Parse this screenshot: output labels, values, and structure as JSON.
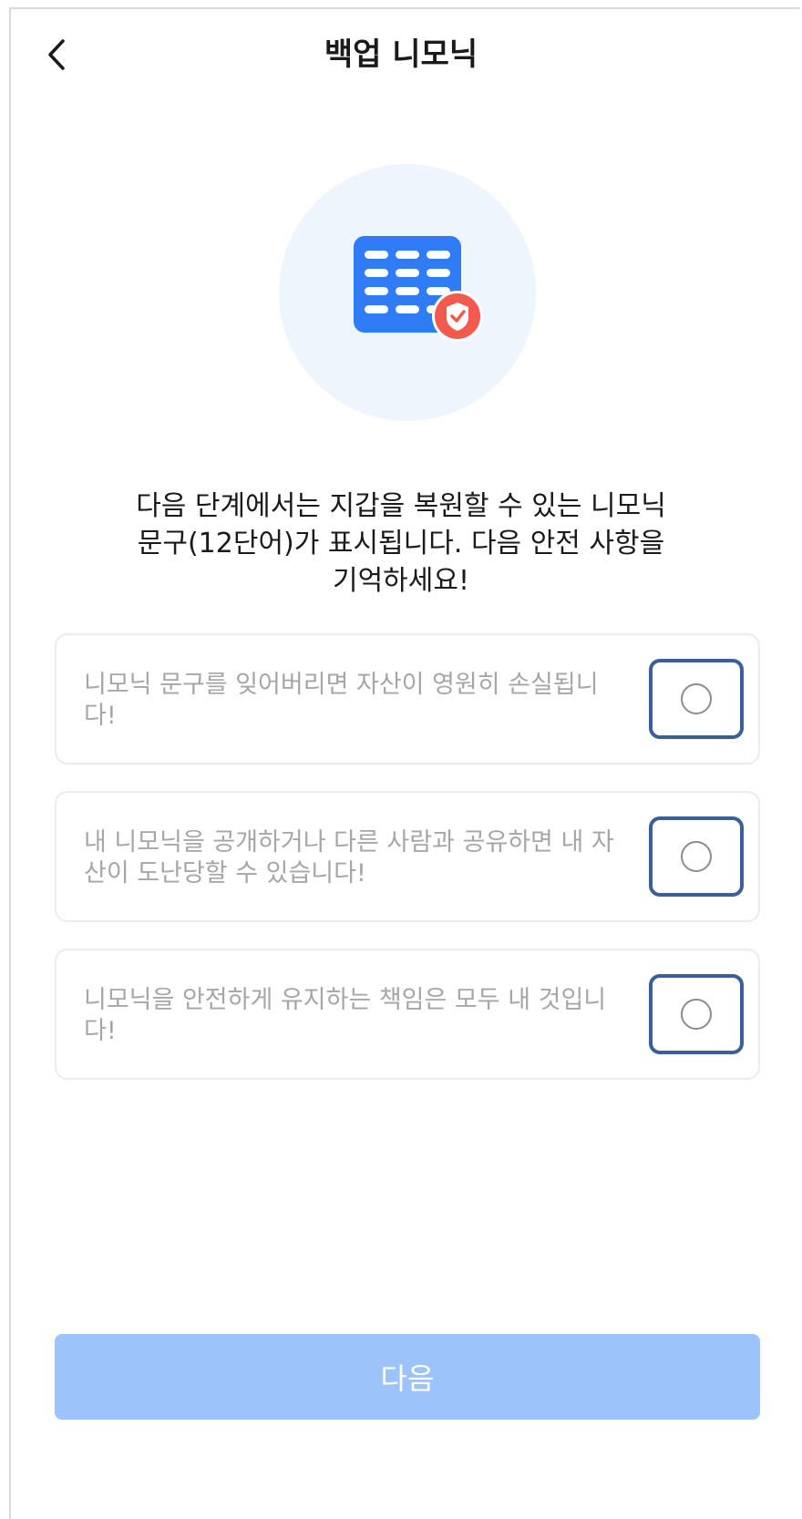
{
  "header": {
    "title": "백업 니모닉",
    "back_icon": "chevron-left-icon"
  },
  "hero": {
    "icon": "mnemonic-shield-icon",
    "colors": {
      "circle": "#eef5fc",
      "card": "#2f7cf6",
      "card_accent": "#3ed9a7",
      "shield": "#f25a4e"
    }
  },
  "intro": {
    "line1": "다음 단계에서는 지갑을 복원할 수 있는 니모닉",
    "line2": "문구(12단어)가 표시됩니다. 다음 안전 사항을",
    "line3": "기억하세요!"
  },
  "checklist": [
    {
      "text": "니모닉 문구를 잊어버리면 자산이 영원히 손실됩니다!",
      "checked": false
    },
    {
      "text": "내 니모닉을 공개하거나 다른 사람과 공유하면 내 자산이 도난당할 수 있습니다!",
      "checked": false
    },
    {
      "text": "니모닉을 안전하게 유지하는 책임은 모두 내 것입니다!",
      "checked": false
    }
  ],
  "next_button": {
    "label": "다음",
    "enabled": false,
    "color": "#9cc4fa"
  }
}
